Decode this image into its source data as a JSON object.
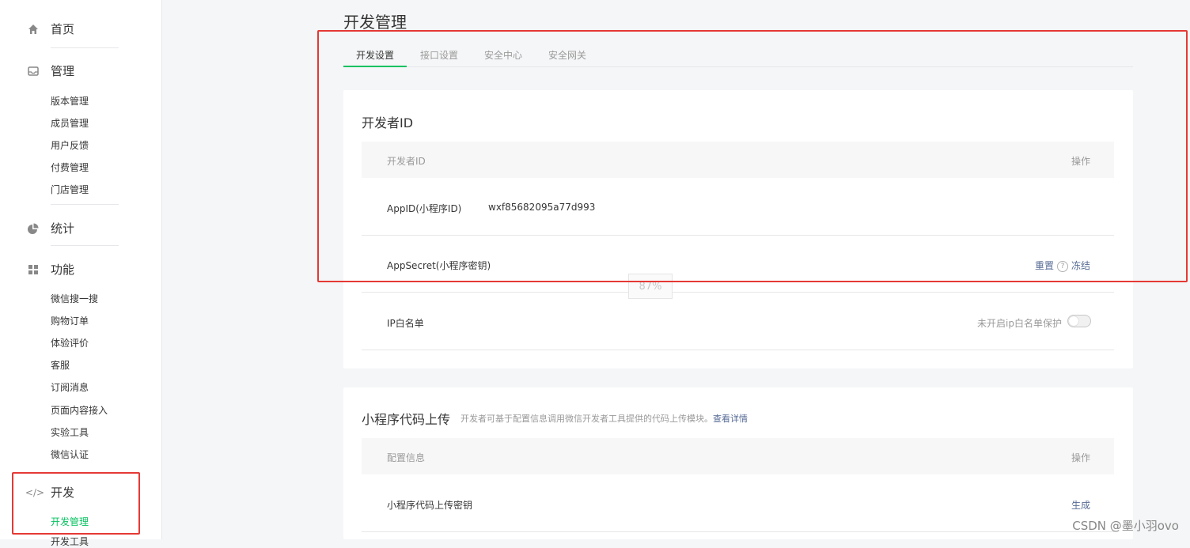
{
  "sidebar": {
    "home": "首页",
    "manage": "管理",
    "manage_items": [
      "版本管理",
      "成员管理",
      "用户反馈",
      "付费管理",
      "门店管理"
    ],
    "stats": "统计",
    "features": "功能",
    "feature_items": [
      "微信搜一搜",
      "购物订单",
      "体验评价",
      "客服",
      "订阅消息",
      "页面内容接入",
      "实验工具",
      "微信认证"
    ],
    "dev": "开发",
    "dev_icon_text": "</>",
    "dev_items": [
      "开发管理",
      "开发工具"
    ]
  },
  "main": {
    "title": "开发管理",
    "tabs": [
      "开发设置",
      "接口设置",
      "安全中心",
      "安全网关"
    ],
    "dev_id_card": {
      "title": "开发者ID",
      "col_left": "开发者ID",
      "col_right": "操作",
      "appid_label": "AppID(小程序ID)",
      "appid_value": "wxf85682095a77d993",
      "secret_label": "AppSecret(小程序密钥)",
      "reset": "重置",
      "help": "?",
      "freeze": "冻结",
      "ip_label": "IP白名单",
      "ip_status": "未开启ip白名单保护"
    },
    "upload_card": {
      "title": "小程序代码上传",
      "desc": "开发者可基于配置信息调用微信开发者工具提供的代码上传模块。",
      "detail_link": "查看详情",
      "col_left": "配置信息",
      "col_right": "操作",
      "key_label": "小程序代码上传密钥",
      "generate": "生成"
    }
  },
  "zoom": "87%",
  "watermark": "CSDN @墨小羽ovo",
  "colors": {
    "accent": "#07c160",
    "link": "#576b95",
    "highlight": "#e53935"
  }
}
